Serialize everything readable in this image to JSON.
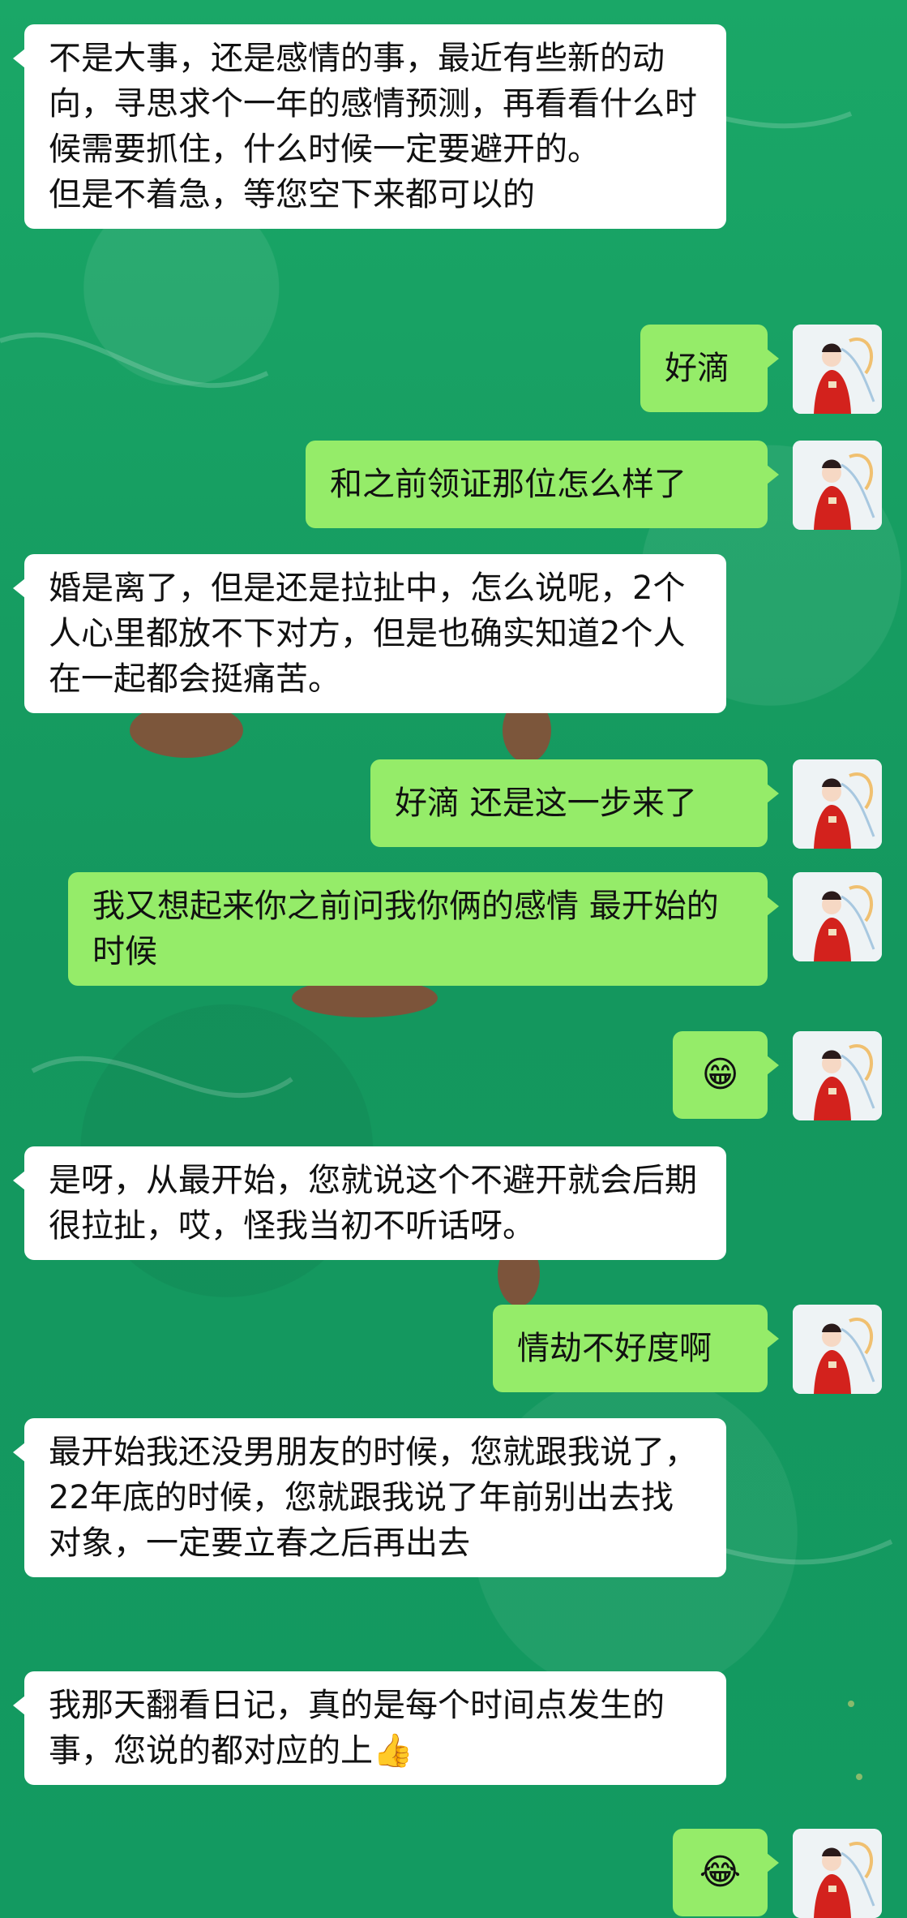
{
  "colors": {
    "background": "#17a064",
    "incoming_bubble": "#ffffff",
    "outgoing_bubble": "#95ec69",
    "text": "#111111"
  },
  "messages": [
    {
      "side": "in",
      "text": "不是大事，还是感情的事，最近有些新的动向，寻思求个一年的感情预测，再看看什么时候需要抓住，什么时候一定要避开的。\n但是不着急，等您空下来都可以的"
    },
    {
      "side": "out",
      "text": "好滴"
    },
    {
      "side": "out",
      "text": "和之前领证那位怎么样了"
    },
    {
      "side": "in",
      "text": "婚是离了，但是还是拉扯中，怎么说呢，2个人心里都放不下对方，但是也确实知道2个人在一起都会挺痛苦。"
    },
    {
      "side": "out",
      "text": "好滴 还是这一步来了"
    },
    {
      "side": "out",
      "text": "我又想起来你之前问我你俩的感情 最开始的时候"
    },
    {
      "side": "out",
      "text": "😁"
    },
    {
      "side": "in",
      "text": "是呀，从最开始，您就说这个不避开就会后期很拉扯，哎，怪我当初不听话呀。"
    },
    {
      "side": "out",
      "text": "情劫不好度啊"
    },
    {
      "side": "in",
      "text": "最开始我还没男朋友的时候，您就跟我说了，22年底的时候，您就跟我说了年前别出去找对象，一定要立春之后再出去"
    },
    {
      "side": "in",
      "text": "我那天翻看日记，真的是每个时间点发生的事，您说的都对应的上👍"
    },
    {
      "side": "out",
      "text": "😂"
    }
  ]
}
